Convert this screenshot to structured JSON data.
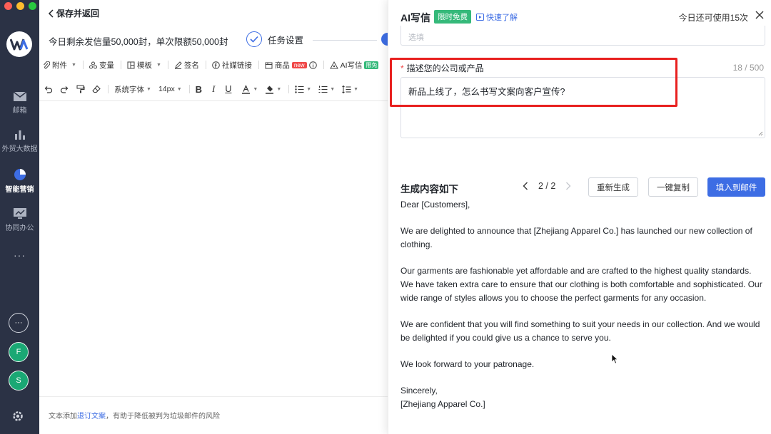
{
  "rail": {
    "items": [
      {
        "label": "邮箱",
        "icon": "mail-icon"
      },
      {
        "label": "外贸大数据",
        "icon": "bar-chart-icon"
      },
      {
        "label": "智能营销",
        "icon": "pie-chart-icon"
      },
      {
        "label": "协同办公",
        "icon": "monitor-icon"
      }
    ],
    "more": "···",
    "avatars": [
      {
        "letter": "F",
        "color": "#1aa874"
      },
      {
        "letter": "S",
        "color": "#1aa874"
      }
    ],
    "more_circle": "···"
  },
  "editor": {
    "back_label": "保存并返回",
    "quota_text": "今日剩余发信量50,000封，单次限额50,000封",
    "task_label": "任务设置",
    "toolbar1": {
      "attach": "附件",
      "variable": "变量",
      "template": "模板",
      "signature": "签名",
      "social": "社媒链接",
      "product": "商品",
      "product_badge": "new",
      "ai": "AI写信",
      "ai_badge": "限免"
    },
    "toolbar2": {
      "font": "系统字体",
      "size": "14px"
    },
    "footer_prefix": "文本添加",
    "footer_link": "退订文案",
    "footer_suffix": "，有助于降低被判为垃圾邮件的风险"
  },
  "panel": {
    "title": "AI写信",
    "free_badge": "限时免费",
    "learn": "快速了解",
    "remaining": "今日还可使用15次",
    "top_field_placeholder": "选填",
    "desc_label": "描述您的公司或产品",
    "char_count": "18 / 500",
    "desc_value": "新品上线了，怎么书写文案向客户宣传?",
    "gen_title": "生成内容如下",
    "page": "2 / 2",
    "btn_regen": "重新生成",
    "btn_copy": "一键复制",
    "btn_fill": "填入到邮件",
    "content": {
      "greeting": "Dear [Customers],",
      "p1": "We are delighted to announce that [Zhejiang Apparel Co.] has launched our new collection of clothing.",
      "p2": "Our garments are fashionable yet affordable and are crafted to the highest quality standards. We have taken extra care to ensure that our clothing is both comfortable and sophisticated. Our wide range of styles allows you to choose the perfect garments for any occasion.",
      "p3": "We are confident that you will find something to suit your needs in our collection. And we would be delighted if you could give us a chance to serve you.",
      "p4": "We look forward to your patronage.",
      "closing": "Sincerely,",
      "sign": "[Zhejiang Apparel Co.]"
    }
  },
  "colors": {
    "rail_bg": "#2b3245",
    "accent": "#3d6de4",
    "free_green": "#35b97a",
    "highlight_red": "#e8201f"
  }
}
